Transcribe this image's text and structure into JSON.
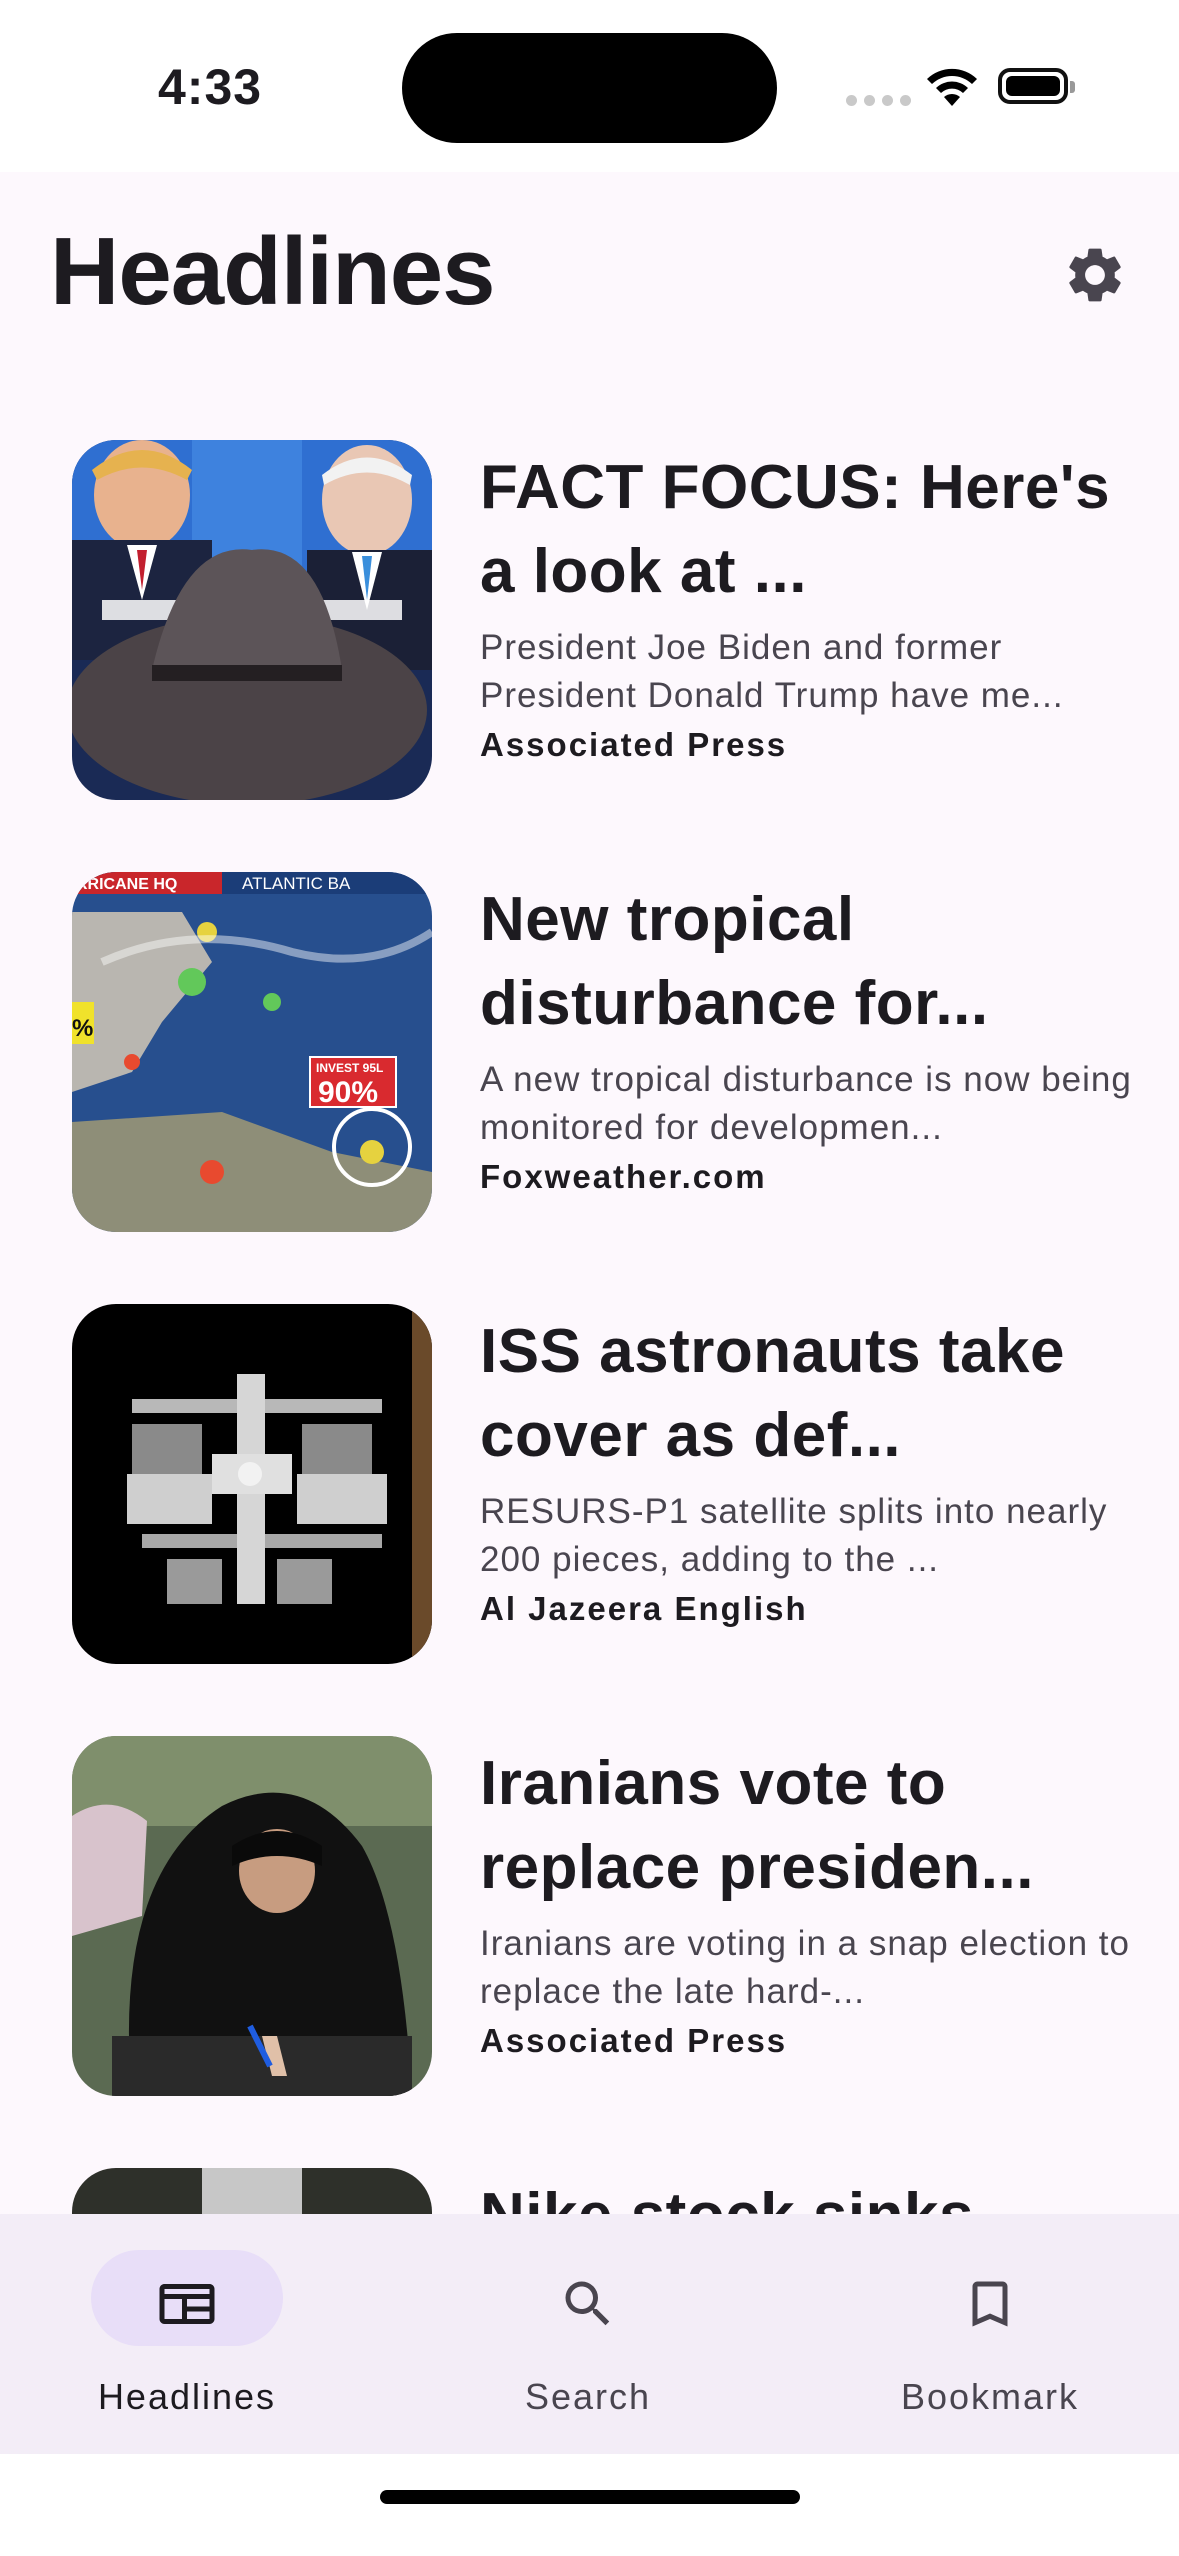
{
  "status_bar": {
    "time": "4:33"
  },
  "header": {
    "title": "Headlines",
    "settings_icon": "gear-icon"
  },
  "articles": [
    {
      "headline": "FACT FOCUS: Here's a look at ...",
      "summary": "President Joe Biden and former President Donald Trump have me...",
      "source": "Associated Press",
      "image": "debate-photo"
    },
    {
      "headline": "New tropical disturbance for...",
      "summary": "A new tropical disturbance is now being monitored for developmen...",
      "source": "Foxweather.com",
      "image": "hurricane-map",
      "image_text": {
        "banner_left": "RRICANE HQ",
        "banner_right": "ATLANTIC BA",
        "invest_label": "INVEST 95L",
        "invest_pct": "90%",
        "left_pct": "%"
      }
    },
    {
      "headline": "ISS astronauts take cover as def...",
      "summary": "RESURS-P1 satellite splits into nearly 200 pieces, adding to the ...",
      "source": "Al Jazeera English",
      "image": "space-station"
    },
    {
      "headline": "Iranians vote to replace presiden...",
      "summary": "Iranians are voting in a snap election to replace the late hard-...",
      "source": "Associated Press",
      "image": "voter-photo"
    },
    {
      "headline": "Nike stock sinks",
      "summary": "",
      "source": "",
      "image": "partial-photo"
    }
  ],
  "bottom_nav": {
    "items": [
      {
        "label": "Headlines",
        "icon": "newspaper-icon",
        "active": true
      },
      {
        "label": "Search",
        "icon": "search-icon",
        "active": false
      },
      {
        "label": "Bookmark",
        "icon": "bookmark-icon",
        "active": false
      }
    ]
  },
  "colors": {
    "background": "#fdf8fd",
    "nav_background": "#f3edf7",
    "active_pill": "#e8def8",
    "text_primary": "#1d1b20",
    "text_secondary": "#49454f"
  }
}
